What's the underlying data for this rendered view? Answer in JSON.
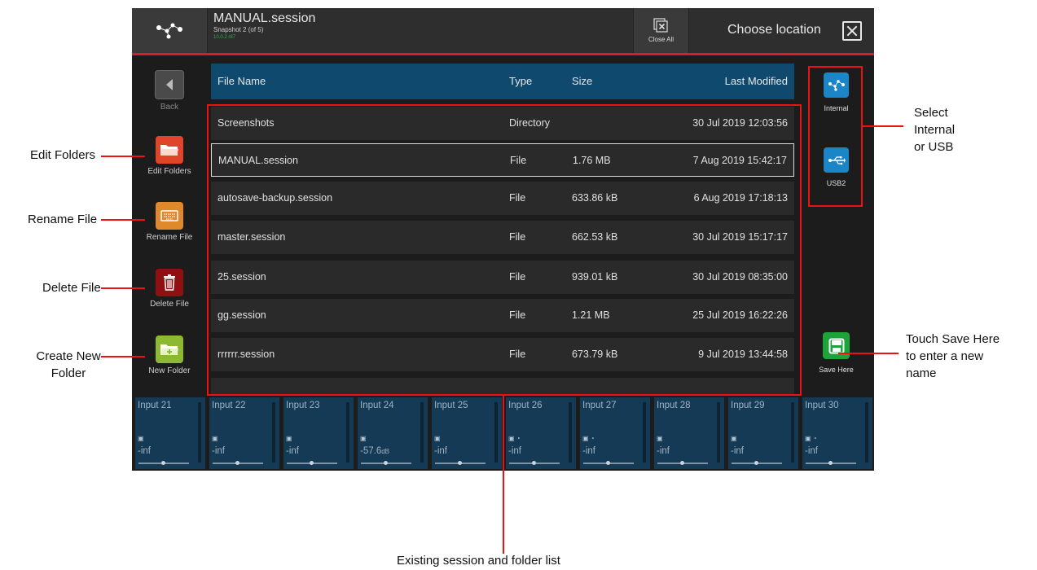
{
  "header": {
    "session_title": "MANUAL.session",
    "session_snapshot": "Snapshot 2 (of 5)",
    "session_sub": "10.0.2 r87",
    "close_all": "Close All",
    "choose_location": "Choose location"
  },
  "sidebar": {
    "back": "Back",
    "edit_folders": "Edit Folders",
    "rename_file": "Rename File",
    "delete_file": "Delete File",
    "new_folder": "New Folder"
  },
  "table": {
    "columns": {
      "name": "File Name",
      "type": "Type",
      "size": "Size",
      "modified": "Last Modified"
    },
    "rows": [
      {
        "name": "Screenshots",
        "type": "Directory",
        "size": "",
        "modified": "30 Jul 2019 12:03:56"
      },
      {
        "name": "MANUAL.session",
        "type": "File",
        "size": "1.76 MB",
        "modified": "7 Aug 2019 15:42:17"
      },
      {
        "name": "autosave-backup.session",
        "type": "File",
        "size": "633.86 kB",
        "modified": "6 Aug 2019 17:18:13"
      },
      {
        "name": "master.session",
        "type": "File",
        "size": "662.53 kB",
        "modified": "30 Jul 2019 15:17:17"
      },
      {
        "name": "25.session",
        "type": "File",
        "size": "939.01 kB",
        "modified": "30 Jul 2019 08:35:00"
      },
      {
        "name": "gg.session",
        "type": "File",
        "size": "1.21 MB",
        "modified": "25 Jul 2019 16:22:26"
      },
      {
        "name": "rrrrrr.session",
        "type": "File",
        "size": "673.79 kB",
        "modified": "9 Jul 2019 13:44:58"
      }
    ]
  },
  "locations": {
    "internal": "Internal",
    "usb": "USB2",
    "save_here": "Save Here"
  },
  "channels": [
    {
      "name": "Input 21",
      "value": "-inf",
      "unit": ""
    },
    {
      "name": "Input 22",
      "value": "-inf",
      "unit": ""
    },
    {
      "name": "Input 23",
      "value": "-inf",
      "unit": ""
    },
    {
      "name": "Input 24",
      "value": "-57.6",
      "unit": "dB"
    },
    {
      "name": "Input 25",
      "value": "-inf",
      "unit": ""
    },
    {
      "name": "Input 26",
      "value": "-inf",
      "unit": ""
    },
    {
      "name": "Input 27",
      "value": "-inf",
      "unit": ""
    },
    {
      "name": "Input 28",
      "value": "-inf",
      "unit": ""
    },
    {
      "name": "Input 29",
      "value": "-inf",
      "unit": ""
    },
    {
      "name": "Input 30",
      "value": "-inf",
      "unit": ""
    }
  ],
  "annotations": {
    "edit_folders": "Edit Folders",
    "rename_file": "Rename File",
    "delete_file": "Delete File",
    "create_new_folder_1": "Create New",
    "create_new_folder_2": "Folder",
    "select_1": "Select",
    "select_2": "Internal",
    "select_3": "or USB",
    "save_1": "Touch Save Here",
    "save_2": "to enter a new",
    "save_3": "name",
    "list": "Existing session and folder list"
  },
  "colors": {
    "accent_red": "#d4202a",
    "header_blue": "#0f4a6e",
    "internal_blue": "#1a86c8",
    "edit_red": "#e0452a",
    "rename_orange": "#e0892a",
    "delete_darkred": "#8f1010",
    "newfolder_green": "#8db832",
    "save_green": "#1ea33a"
  }
}
